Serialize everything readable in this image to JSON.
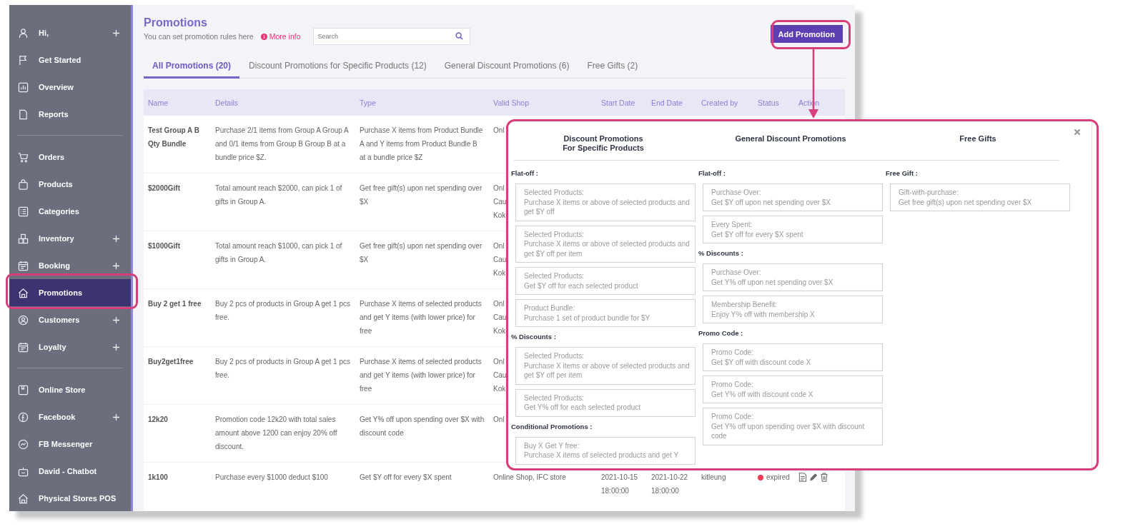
{
  "sidebar": {
    "groups": [
      {
        "items": [
          {
            "label": "Hi,",
            "expandable": true,
            "selected": false
          },
          {
            "label": "Get Started",
            "expandable": false,
            "selected": false
          },
          {
            "label": "Overview",
            "expandable": false,
            "selected": false
          },
          {
            "label": "Reports",
            "expandable": false,
            "selected": false
          }
        ]
      },
      {
        "items": [
          {
            "label": "Orders",
            "expandable": false,
            "selected": false
          },
          {
            "label": "Products",
            "expandable": false,
            "selected": false
          },
          {
            "label": "Categories",
            "expandable": false,
            "selected": false
          },
          {
            "label": "Inventory",
            "expandable": true,
            "selected": false
          },
          {
            "label": "Booking",
            "expandable": true,
            "selected": false
          },
          {
            "label": "Promotions",
            "expandable": false,
            "selected": true
          },
          {
            "label": "Customers",
            "expandable": true,
            "selected": false
          },
          {
            "label": "Loyalty",
            "expandable": true,
            "selected": false
          }
        ]
      },
      {
        "items": [
          {
            "label": "Online Store",
            "expandable": false,
            "selected": false
          },
          {
            "label": "Facebook",
            "expandable": true,
            "selected": false
          },
          {
            "label": "FB Messenger",
            "expandable": false,
            "selected": false
          },
          {
            "label": "David - Chatbot",
            "expandable": false,
            "selected": false
          },
          {
            "label": "Physical Stores POS",
            "expandable": false,
            "selected": false
          }
        ]
      }
    ]
  },
  "header": {
    "title": "Promotions",
    "subtitle": "You can set promotion rules here",
    "more_info": "More info",
    "search": {
      "placeholder": "Search"
    },
    "add_button": "Add Promotion"
  },
  "tabs": [
    {
      "label": "All Promotions (20)",
      "selected": true
    },
    {
      "label": "Discount Promotions for Specific Products (12)",
      "selected": false
    },
    {
      "label": "General Discount Promotions (6)",
      "selected": false
    },
    {
      "label": "Free Gifts (2)",
      "selected": false
    }
  ],
  "table": {
    "columns": [
      "Name",
      "Details",
      "Type",
      "Valid Shop",
      "Start Date",
      "End Date",
      "Created by",
      "Status",
      "Action"
    ],
    "rows": [
      {
        "name": "Test Group A B Qty Bundle",
        "details": "Purchase 2/1 items from Group A Group A and 0/1 items from Group B Group B at a bundle price $Z.",
        "type": "Purchase X items from Product Bundle A and Y items from Product Bundle B at a bundle price $Z",
        "valid_shop": "Onl"
      },
      {
        "name": "$2000Gift",
        "details": "Total amount reach $2000, can pick 1 of gifts in Group A.",
        "type": "Get free gift(s) upon net spending over $X",
        "valid_shop": "Onl\nCau\nKok"
      },
      {
        "name": "$1000Gift",
        "details": "Total amount reach $1000, can pick 1 of gifts in Group A.",
        "type": "Get free gift(s) upon net spending over $X",
        "valid_shop": "Onl\nCau\nKok"
      },
      {
        "name": "Buy 2 get 1 free",
        "details": "Buy 2 pcs of products in Group A get 1 pcs free.",
        "type": "Purchase X items of selected products and get Y items (with lower price) for free",
        "valid_shop": "Onl\nCau\nKok"
      },
      {
        "name": "Buy2get1free",
        "details": "Buy 2 pcs of products in Group A get 1 pcs free.",
        "type": "Purchase X items of selected products and get Y items (with lower price) for free",
        "valid_shop": "Onl\nCau\nKok"
      },
      {
        "name": "12k20",
        "details": "Promotion code 12k20 with total sales amount above 1200 can enjoy 20% off discount.",
        "type": "Get Y% off upon spending over $X with discount code",
        "valid_shop": "Onl"
      },
      {
        "name": "1k100",
        "details": "Purchase every $1000 deduct $100",
        "type": "Get $Y off for every $X spent",
        "valid_shop": "Online Shop, IFC store",
        "start_date": "2021-10-15 18:00:00",
        "end_date": "2021-10-22 18:00:00",
        "created_by": "kitleung",
        "status": {
          "label": "expired",
          "color": "#ec3b55"
        }
      }
    ]
  },
  "popup": {
    "columns": [
      {
        "title": "Discount Promotions\nFor Specific Products",
        "sections": [
          {
            "label": "Flat-off :",
            "options": [
              {
                "name": "Selected Products:",
                "description": "Purchase X items or above of selected products and get $Y off"
              },
              {
                "name": "Selected Products:",
                "description": "Purchase X items or above of selected products and get $Y off per item"
              },
              {
                "name": "Selected Products:",
                "description": "Get $Y off for each selected product"
              },
              {
                "name": "Product Bundle:",
                "description": "Purchase 1 set of product bundle for $Y"
              }
            ]
          },
          {
            "label": "% Discounts :",
            "options": [
              {
                "name": "Selected Products:",
                "description": "Purchase X items or above of selected products and get $Y off per item"
              },
              {
                "name": "Selected Products:",
                "description": "Get Y% off for each selected product"
              }
            ]
          },
          {
            "label": "Conditional Promotions :",
            "options": [
              {
                "name": "Buy X Get Y free:",
                "description": "Purchase X items of selected products and get Y"
              }
            ]
          }
        ]
      },
      {
        "title": "General Discount Promotions",
        "sections": [
          {
            "label": "Flat-off :",
            "options": [
              {
                "name": "Purchase Over:",
                "description": "Get $Y off upon net spending over $X"
              },
              {
                "name": "Every Spent:",
                "description": "Get $Y off for every $X spent"
              }
            ]
          },
          {
            "label": "% Discounts :",
            "options": [
              {
                "name": "Purchase Over:",
                "description": "Get Y% off upon net spending over $X"
              },
              {
                "name": "Membership Benefit:",
                "description": "Enjoy Y% off with membership X"
              }
            ]
          },
          {
            "label": "Promo Code :",
            "options": [
              {
                "name": "Promo Code:",
                "description": "Get $Y off with discount code X"
              },
              {
                "name": "Promo Code:",
                "description": "Get Y% off with discount code X"
              },
              {
                "name": "Promo Code:",
                "description": "Get Y% off upon spending over $X with discount code"
              }
            ]
          }
        ]
      },
      {
        "title": "Free Gifts",
        "sections": [
          {
            "label": "Free Gift :",
            "options": [
              {
                "name": "Gift-with-purchase:",
                "description": "Get free gift(s) upon net spending over $X"
              }
            ]
          }
        ]
      }
    ]
  }
}
